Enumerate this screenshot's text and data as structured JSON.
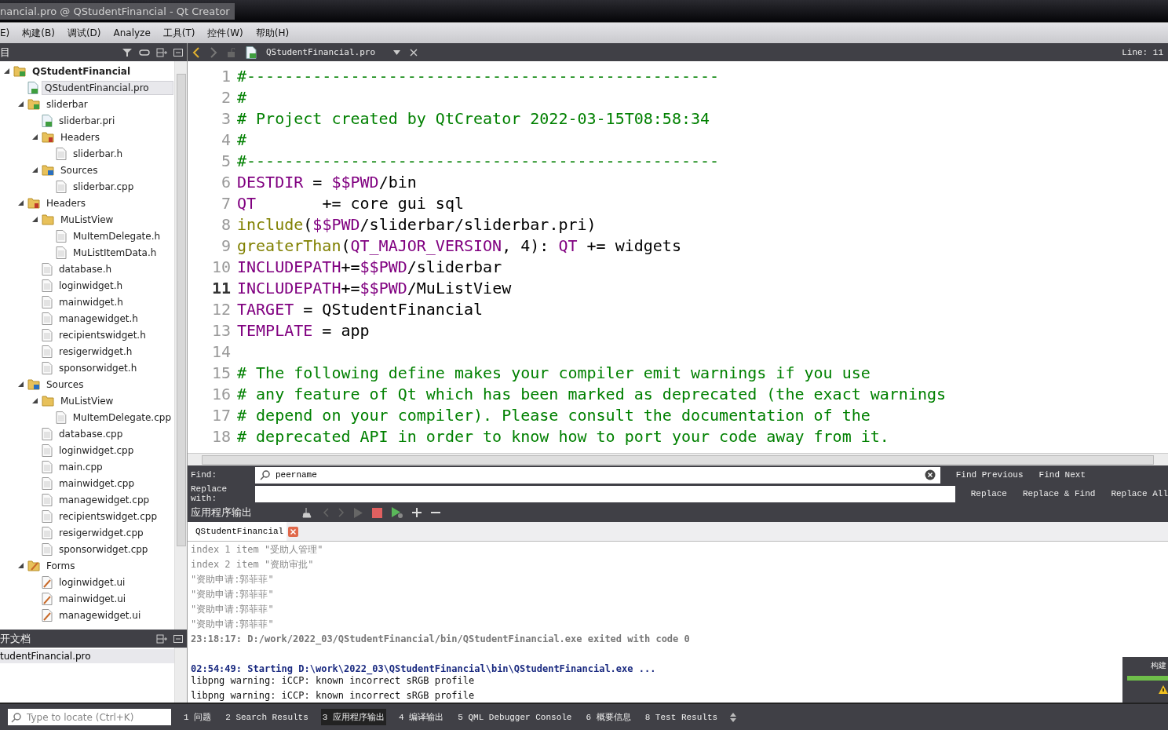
{
  "window": {
    "title": "nancial.pro @ QStudentFinancial - Qt Creator"
  },
  "menu": [
    "E)",
    "构建(B)",
    "调试(D)",
    "Analyze",
    "工具(T)",
    "控件(W)",
    "帮助(H)"
  ],
  "sidebar": {
    "title": "目",
    "tree": [
      {
        "label": "QStudentFinancial",
        "kind": "project",
        "expanded": true,
        "selected": false,
        "children": [
          {
            "label": "QStudentFinancial.pro",
            "kind": "pro",
            "selected": true
          },
          {
            "label": "sliderbar",
            "kind": "project",
            "expanded": true,
            "selected": false,
            "children": [
              {
                "label": "sliderbar.pri",
                "kind": "pro",
                "selected": false
              },
              {
                "label": "Headers",
                "kind": "headers",
                "expanded": true,
                "selected": false,
                "children": [
                  {
                    "label": "sliderbar.h",
                    "kind": "file",
                    "selected": false
                  }
                ]
              },
              {
                "label": "Sources",
                "kind": "sources",
                "expanded": true,
                "selected": false,
                "children": [
                  {
                    "label": "sliderbar.cpp",
                    "kind": "file",
                    "selected": false
                  }
                ]
              }
            ]
          },
          {
            "label": "Headers",
            "kind": "headers",
            "expanded": true,
            "selected": false,
            "children": [
              {
                "label": "MuListView",
                "kind": "folder",
                "expanded": true,
                "selected": false,
                "children": [
                  {
                    "label": "MuItemDelegate.h",
                    "kind": "file",
                    "selected": false
                  },
                  {
                    "label": "MuListItemData.h",
                    "kind": "file",
                    "selected": false
                  }
                ]
              },
              {
                "label": "database.h",
                "kind": "file",
                "selected": false
              },
              {
                "label": "loginwidget.h",
                "kind": "file",
                "selected": false
              },
              {
                "label": "mainwidget.h",
                "kind": "file",
                "selected": false
              },
              {
                "label": "managewidget.h",
                "kind": "file",
                "selected": false
              },
              {
                "label": "recipientswidget.h",
                "kind": "file",
                "selected": false
              },
              {
                "label": "resigerwidget.h",
                "kind": "file",
                "selected": false
              },
              {
                "label": "sponsorwidget.h",
                "kind": "file",
                "selected": false
              }
            ]
          },
          {
            "label": "Sources",
            "kind": "sources",
            "expanded": true,
            "selected": false,
            "children": [
              {
                "label": "MuListView",
                "kind": "folder",
                "expanded": true,
                "selected": false,
                "children": [
                  {
                    "label": "MuItemDelegate.cpp",
                    "kind": "file",
                    "selected": false
                  }
                ]
              },
              {
                "label": "database.cpp",
                "kind": "file",
                "selected": false
              },
              {
                "label": "loginwidget.cpp",
                "kind": "file",
                "selected": false
              },
              {
                "label": "main.cpp",
                "kind": "file",
                "selected": false
              },
              {
                "label": "mainwidget.cpp",
                "kind": "file",
                "selected": false
              },
              {
                "label": "managewidget.cpp",
                "kind": "file",
                "selected": false
              },
              {
                "label": "recipientswidget.cpp",
                "kind": "file",
                "selected": false
              },
              {
                "label": "resigerwidget.cpp",
                "kind": "file",
                "selected": false
              },
              {
                "label": "sponsorwidget.cpp",
                "kind": "file",
                "selected": false
              }
            ]
          },
          {
            "label": "Forms",
            "kind": "forms",
            "expanded": true,
            "selected": false,
            "children": [
              {
                "label": "loginwidget.ui",
                "kind": "ui",
                "selected": false
              },
              {
                "label": "mainwidget.ui",
                "kind": "ui",
                "selected": false
              },
              {
                "label": "managewidget.ui",
                "kind": "ui",
                "selected": false
              }
            ]
          }
        ]
      }
    ]
  },
  "open_documents": {
    "title": "开文档",
    "items": [
      {
        "label": "tudentFinancial.pro",
        "selected": true
      }
    ]
  },
  "editor": {
    "file": "QStudentFinancial.pro",
    "position": "Line: 11",
    "lines": [
      {
        "number": "1",
        "current": false,
        "tokens": [
          {
            "kind": "comment",
            "text": "#--------------------------------------------------"
          }
        ]
      },
      {
        "number": "2",
        "current": false,
        "tokens": [
          {
            "kind": "comment",
            "text": "#"
          }
        ]
      },
      {
        "number": "3",
        "current": false,
        "tokens": [
          {
            "kind": "comment",
            "text": "# Project created by QtCreator 2022-03-15T08:58:34"
          }
        ]
      },
      {
        "number": "4",
        "current": false,
        "tokens": [
          {
            "kind": "comment",
            "text": "#"
          }
        ]
      },
      {
        "number": "5",
        "current": false,
        "tokens": [
          {
            "kind": "comment",
            "text": "#--------------------------------------------------"
          }
        ]
      },
      {
        "number": "6",
        "current": false,
        "tokens": [
          {
            "kind": "var",
            "text": "DESTDIR"
          },
          {
            "kind": "text",
            "text": " = "
          },
          {
            "kind": "var",
            "text": "$$PWD"
          },
          {
            "kind": "text",
            "text": "/bin"
          }
        ]
      },
      {
        "number": "7",
        "current": false,
        "tokens": [
          {
            "kind": "var",
            "text": "QT"
          },
          {
            "kind": "text",
            "text": "       += core gui sql"
          }
        ]
      },
      {
        "number": "8",
        "current": false,
        "tokens": [
          {
            "kind": "func",
            "text": "include"
          },
          {
            "kind": "text",
            "text": "("
          },
          {
            "kind": "var",
            "text": "$$PWD"
          },
          {
            "kind": "text",
            "text": "/sliderbar/sliderbar.pri)"
          }
        ]
      },
      {
        "number": "9",
        "current": false,
        "tokens": [
          {
            "kind": "func",
            "text": "greaterThan"
          },
          {
            "kind": "text",
            "text": "("
          },
          {
            "kind": "var",
            "text": "QT_MAJOR_VERSION"
          },
          {
            "kind": "text",
            "text": ", 4): "
          },
          {
            "kind": "var",
            "text": "QT"
          },
          {
            "kind": "text",
            "text": " += widgets"
          }
        ]
      },
      {
        "number": "10",
        "current": false,
        "tokens": [
          {
            "kind": "var",
            "text": "INCLUDEPATH"
          },
          {
            "kind": "text",
            "text": "+="
          },
          {
            "kind": "var",
            "text": "$$PWD"
          },
          {
            "kind": "text",
            "text": "/sliderbar"
          }
        ]
      },
      {
        "number": "11",
        "current": true,
        "tokens": [
          {
            "kind": "var",
            "text": "INCLUDEPATH"
          },
          {
            "kind": "text",
            "text": "+="
          },
          {
            "kind": "var",
            "text": "$$PWD"
          },
          {
            "kind": "text",
            "text": "/MuListView"
          }
        ]
      },
      {
        "number": "12",
        "current": false,
        "tokens": [
          {
            "kind": "var",
            "text": "TARGET"
          },
          {
            "kind": "text",
            "text": " = QStudentFinancial"
          }
        ]
      },
      {
        "number": "13",
        "current": false,
        "tokens": [
          {
            "kind": "var",
            "text": "TEMPLATE"
          },
          {
            "kind": "text",
            "text": " = app"
          }
        ]
      },
      {
        "number": "14",
        "current": false
      },
      {
        "number": "15",
        "current": false,
        "tokens": [
          {
            "kind": "comment",
            "text": "# The following define makes your compiler emit warnings if you use"
          }
        ]
      },
      {
        "number": "16",
        "current": false,
        "tokens": [
          {
            "kind": "comment",
            "text": "# any feature of Qt which has been marked as deprecated (the exact warnings"
          }
        ]
      },
      {
        "number": "17",
        "current": false,
        "tokens": [
          {
            "kind": "comment",
            "text": "# depend on your compiler). Please consult the documentation of the"
          }
        ]
      },
      {
        "number": "18",
        "current": false,
        "tokens": [
          {
            "kind": "comment",
            "text": "# deprecated API in order to know how to port your code away from it."
          }
        ]
      }
    ]
  },
  "find_bar": {
    "find_label": "Find:",
    "find_value": "peername",
    "replace_label": "Replace with:",
    "buttons": [
      "Find Previous",
      "Find Next",
      "Replace",
      "Replace & Find",
      "Replace All"
    ]
  },
  "output": {
    "title": "应用程序输出",
    "tab": "QStudentFinancial",
    "lines": [
      {
        "kind": "debug",
        "text": "index 1 item \"受助人管理\""
      },
      {
        "kind": "debug",
        "text": "index 2 item \"资助审批\""
      },
      {
        "kind": "debug",
        "text": "\"资助申请:郭菲菲\""
      },
      {
        "kind": "debug",
        "text": "\"资助申请:郭菲菲\""
      },
      {
        "kind": "debug",
        "text": "\"资助申请:郭菲菲\""
      },
      {
        "kind": "debug",
        "text": "\"资助申请:郭菲菲\""
      },
      {
        "kind": "exit",
        "text": "23:18:17: D:/work/2022_03/QStudentFinancial/bin/QStudentFinancial.exe exited with code 0"
      },
      {
        "kind": "blank"
      },
      {
        "kind": "start",
        "text": "02:54:49: Starting D:\\work\\2022_03\\QStudentFinancial\\bin\\QStudentFinancial.exe ..."
      },
      {
        "kind": "stderr",
        "text": "libpng warning: iCCP: known incorrect sRGB profile"
      },
      {
        "kind": "stderr",
        "text": "libpng warning: iCCP: known incorrect sRGB profile"
      }
    ]
  },
  "build_progress": {
    "label": "构建",
    "level": 1
  },
  "locator": {
    "placeholder": "Type to locate (Ctrl+K)"
  },
  "bottom_tabs": [
    {
      "label": "1 问题",
      "selected": false
    },
    {
      "label": "2 Search Results",
      "selected": false
    },
    {
      "label": "3 应用程序输出",
      "selected": true
    },
    {
      "label": "4 编译输出",
      "selected": false
    },
    {
      "label": "5 QML Debugger Console",
      "selected": false
    },
    {
      "label": "6 概要信息",
      "selected": false
    },
    {
      "label": "8 Test Results",
      "selected": false
    }
  ]
}
